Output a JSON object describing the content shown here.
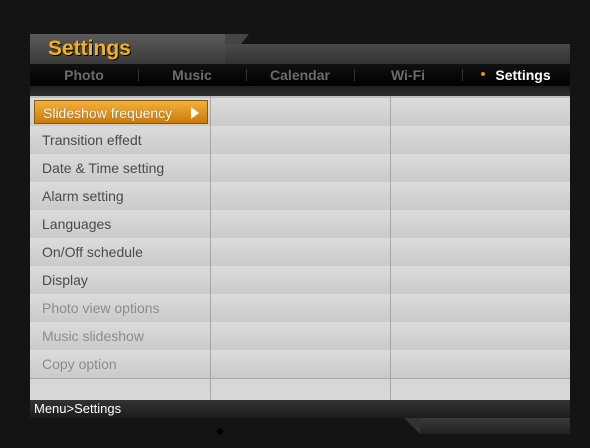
{
  "header": {
    "title": "Settings"
  },
  "tabs": [
    {
      "label": "Photo",
      "active": false
    },
    {
      "label": "Music",
      "active": false
    },
    {
      "label": "Calendar",
      "active": false
    },
    {
      "label": "Wi-Fi",
      "active": false
    },
    {
      "label": "Settings",
      "active": true
    }
  ],
  "menu": {
    "items": [
      {
        "label": "Slideshow frequency",
        "selected": true,
        "dim": false
      },
      {
        "label": "Transition effedt",
        "selected": false,
        "dim": false
      },
      {
        "label": "Date & Time setting",
        "selected": false,
        "dim": false
      },
      {
        "label": "Alarm setting",
        "selected": false,
        "dim": false
      },
      {
        "label": "Languages",
        "selected": false,
        "dim": false
      },
      {
        "label": "On/Off schedule",
        "selected": false,
        "dim": false
      },
      {
        "label": "Display",
        "selected": false,
        "dim": false
      },
      {
        "label": "Photo view options",
        "selected": false,
        "dim": true
      },
      {
        "label": "Music slideshow",
        "selected": false,
        "dim": true
      },
      {
        "label": "Copy option",
        "selected": false,
        "dim": true
      }
    ]
  },
  "breadcrumb": {
    "text": "Menu>Settings"
  },
  "colors": {
    "accent": "#f5b11c",
    "selected_bg": "#e0951f",
    "tab_active": "#ffffff",
    "tab_dot": "#e88a17"
  }
}
